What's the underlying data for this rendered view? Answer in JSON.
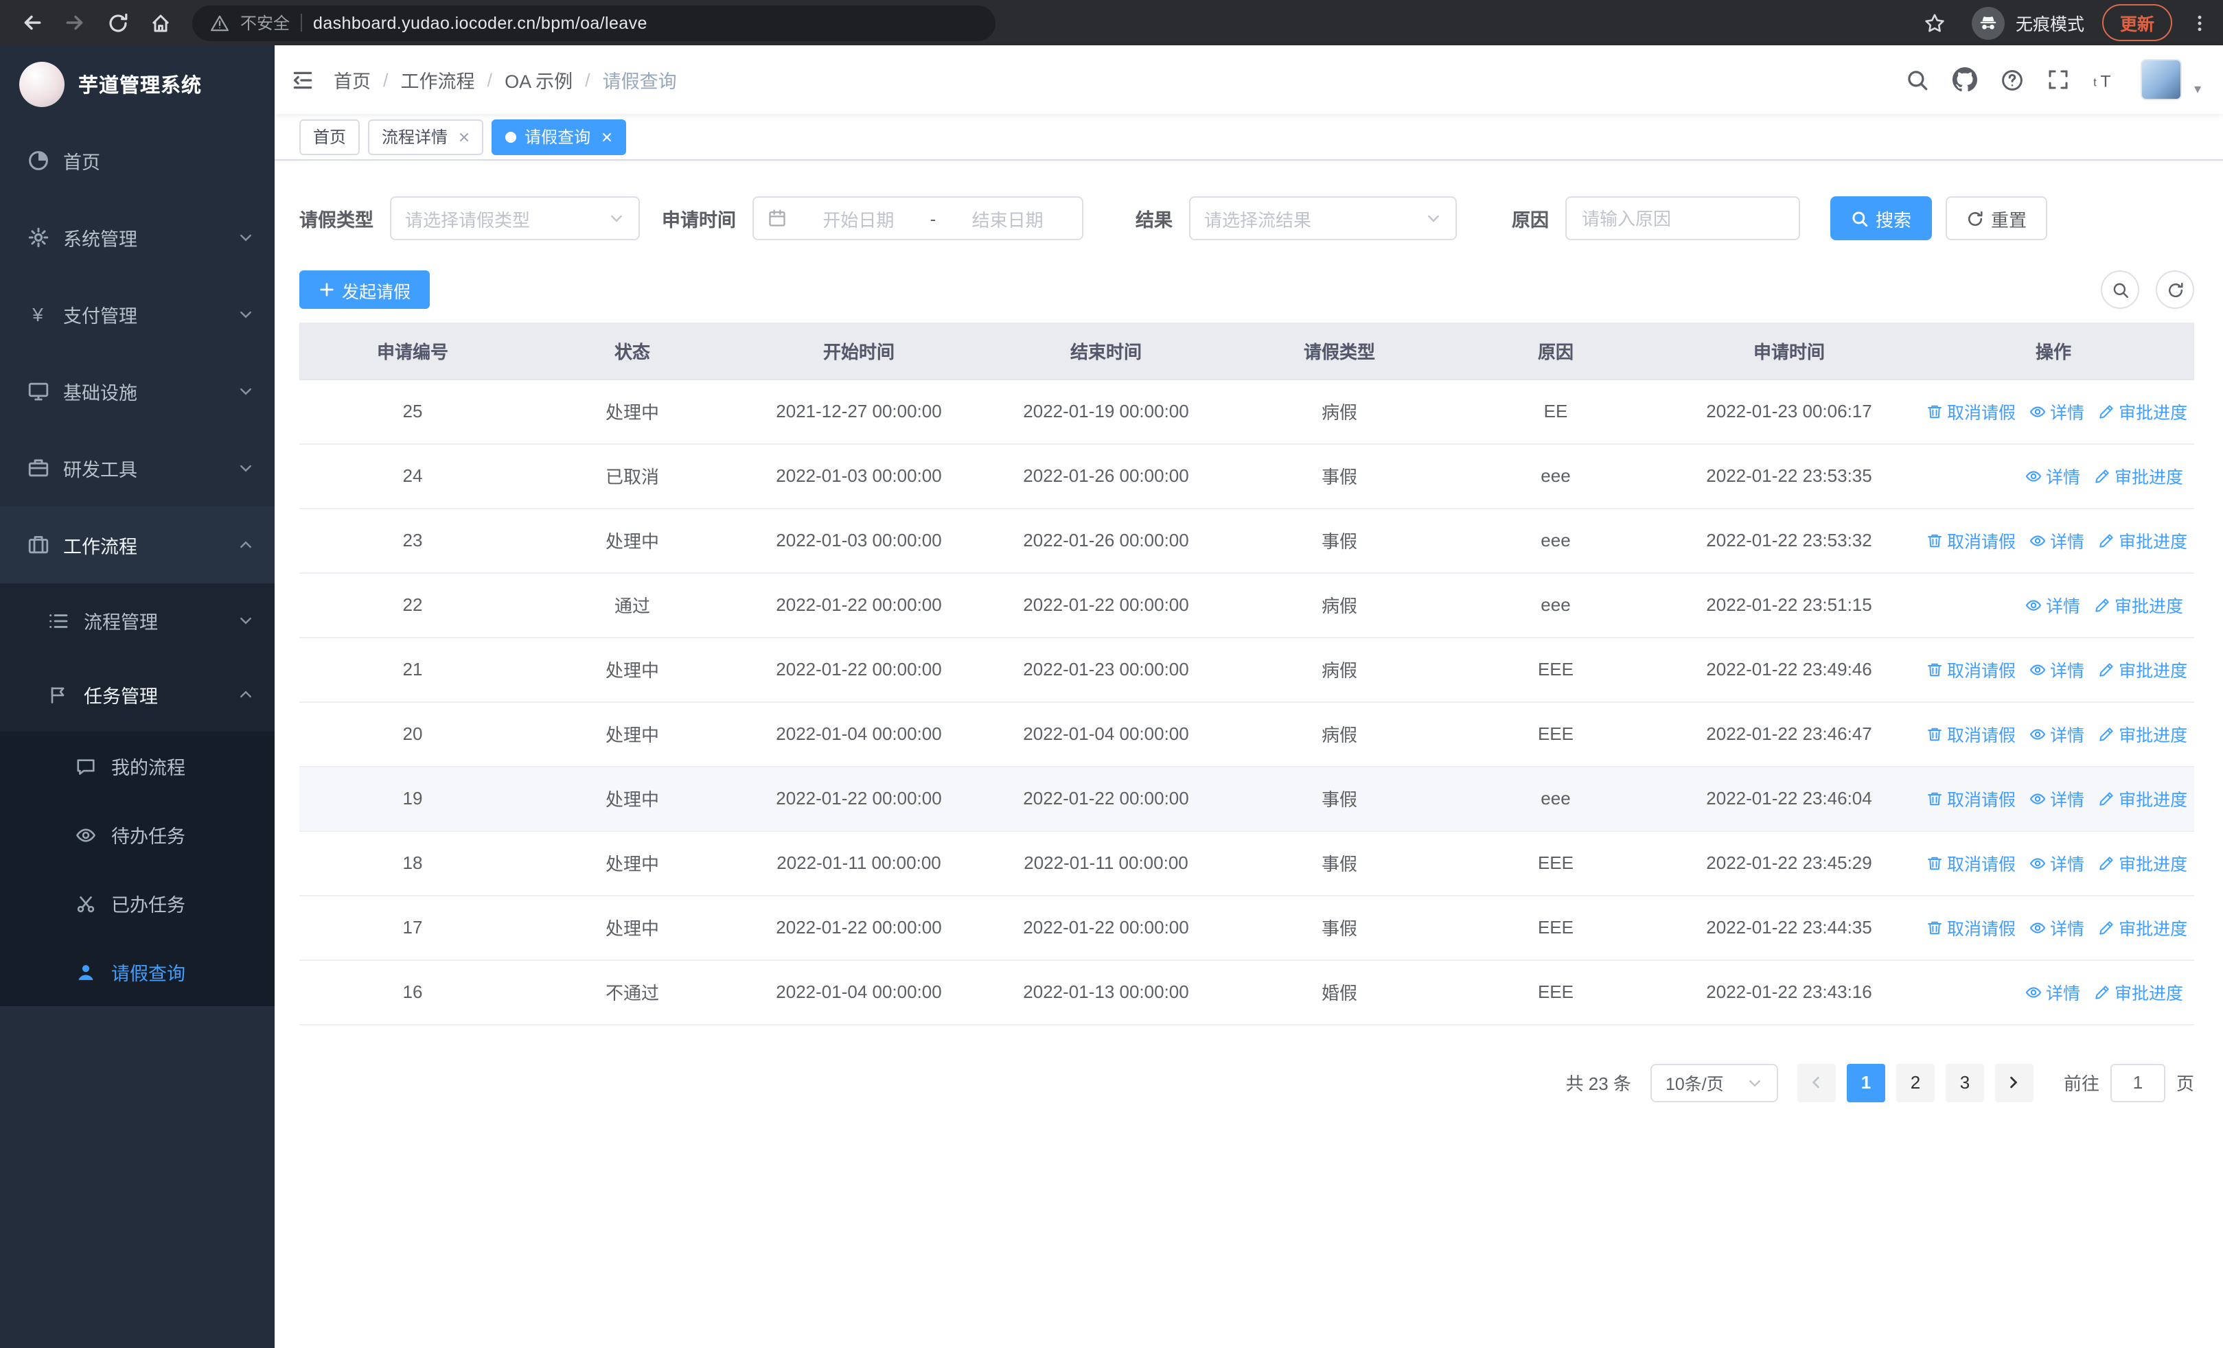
{
  "colors": {
    "primary": "#409eff",
    "update_accent": "#e2603f",
    "sidebar_bg": "#232d3c",
    "table_header_bg": "#e9ebef"
  },
  "browser": {
    "security_label": "不安全",
    "url": "dashboard.yudao.iocoder.cn/bpm/oa/leave",
    "incognito_label": "无痕模式",
    "update_label": "更新"
  },
  "app": {
    "logo_title": "芋道管理系统"
  },
  "sidebar": {
    "items": [
      {
        "label": "首页",
        "icon": "dashboard-icon"
      },
      {
        "label": "系统管理",
        "icon": "gear-icon",
        "chevron": "down"
      },
      {
        "label": "支付管理",
        "icon": "yen-icon",
        "chevron": "down"
      },
      {
        "label": "基础设施",
        "icon": "monitor-icon",
        "chevron": "down"
      },
      {
        "label": "研发工具",
        "icon": "briefcase-icon",
        "chevron": "down"
      },
      {
        "label": "工作流程",
        "icon": "suitcase-icon",
        "chevron": "up"
      },
      {
        "label": "流程管理",
        "icon": "list-icon",
        "chevron": "down"
      },
      {
        "label": "任务管理",
        "icon": "flag-icon",
        "chevron": "up"
      },
      {
        "label": "我的流程",
        "icon": "chat-icon"
      },
      {
        "label": "待办任务",
        "icon": "eye-icon"
      },
      {
        "label": "已办任务",
        "icon": "scissors-icon"
      },
      {
        "label": "请假查询",
        "icon": "user-icon",
        "active": true
      }
    ]
  },
  "breadcrumb": {
    "items": [
      "首页",
      "工作流程",
      "OA 示例",
      "请假查询"
    ],
    "separator": "/"
  },
  "tabs": [
    {
      "label": "首页",
      "closable": false,
      "active": false
    },
    {
      "label": "流程详情",
      "closable": true,
      "active": false
    },
    {
      "label": "请假查询",
      "closable": true,
      "active": true
    }
  ],
  "filters": {
    "leave_type_label": "请假类型",
    "leave_type_placeholder": "请选择请假类型",
    "apply_time_label": "申请时间",
    "start_date_placeholder": "开始日期",
    "range_separator": "-",
    "end_date_placeholder": "结束日期",
    "result_label": "结果",
    "result_placeholder": "请选择流结果",
    "reason_label": "原因",
    "reason_placeholder": "请输入原因",
    "search_label": "搜索",
    "reset_label": "重置"
  },
  "toolbar": {
    "create_label": "发起请假"
  },
  "table": {
    "columns": [
      "申请编号",
      "状态",
      "开始时间",
      "结束时间",
      "请假类型",
      "原因",
      "申请时间",
      "操作"
    ],
    "action_labels": {
      "cancel": "取消请假",
      "detail": "详情",
      "progress": "审批进度"
    },
    "rows": [
      {
        "no": "25",
        "status": "处理中",
        "start": "2021-12-27 00:00:00",
        "end": "2022-01-19 00:00:00",
        "type": "病假",
        "reason": "EE",
        "applied": "2022-01-23 00:06:17",
        "cancellable": true,
        "hover": false
      },
      {
        "no": "24",
        "status": "已取消",
        "start": "2022-01-03 00:00:00",
        "end": "2022-01-26 00:00:00",
        "type": "事假",
        "reason": "eee",
        "applied": "2022-01-22 23:53:35",
        "cancellable": false,
        "hover": false
      },
      {
        "no": "23",
        "status": "处理中",
        "start": "2022-01-03 00:00:00",
        "end": "2022-01-26 00:00:00",
        "type": "事假",
        "reason": "eee",
        "applied": "2022-01-22 23:53:32",
        "cancellable": true,
        "hover": false
      },
      {
        "no": "22",
        "status": "通过",
        "start": "2022-01-22 00:00:00",
        "end": "2022-01-22 00:00:00",
        "type": "病假",
        "reason": "eee",
        "applied": "2022-01-22 23:51:15",
        "cancellable": false,
        "hover": false
      },
      {
        "no": "21",
        "status": "处理中",
        "start": "2022-01-22 00:00:00",
        "end": "2022-01-23 00:00:00",
        "type": "病假",
        "reason": "EEE",
        "applied": "2022-01-22 23:49:46",
        "cancellable": true,
        "hover": false
      },
      {
        "no": "20",
        "status": "处理中",
        "start": "2022-01-04 00:00:00",
        "end": "2022-01-04 00:00:00",
        "type": "病假",
        "reason": "EEE",
        "applied": "2022-01-22 23:46:47",
        "cancellable": true,
        "hover": false
      },
      {
        "no": "19",
        "status": "处理中",
        "start": "2022-01-22 00:00:00",
        "end": "2022-01-22 00:00:00",
        "type": "事假",
        "reason": "eee",
        "applied": "2022-01-22 23:46:04",
        "cancellable": true,
        "hover": true
      },
      {
        "no": "18",
        "status": "处理中",
        "start": "2022-01-11 00:00:00",
        "end": "2022-01-11 00:00:00",
        "type": "事假",
        "reason": "EEE",
        "applied": "2022-01-22 23:45:29",
        "cancellable": true,
        "hover": false
      },
      {
        "no": "17",
        "status": "处理中",
        "start": "2022-01-22 00:00:00",
        "end": "2022-01-22 00:00:00",
        "type": "事假",
        "reason": "EEE",
        "applied": "2022-01-22 23:44:35",
        "cancellable": true,
        "hover": false
      },
      {
        "no": "16",
        "status": "不通过",
        "start": "2022-01-04 00:00:00",
        "end": "2022-01-13 00:00:00",
        "type": "婚假",
        "reason": "EEE",
        "applied": "2022-01-22 23:43:16",
        "cancellable": false,
        "hover": false
      }
    ]
  },
  "pagination": {
    "total_label": "共 23 条",
    "page_size_label": "10条/页",
    "pages": [
      "1",
      "2",
      "3"
    ],
    "active_page": "1",
    "goto_label": "前往",
    "goto_value": "1",
    "unit_label": "页"
  }
}
